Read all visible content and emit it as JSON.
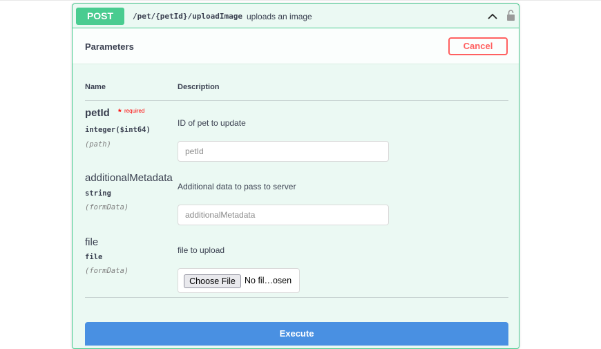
{
  "operation": {
    "method": "POST",
    "path": "/pet/{petId}/uploadImage",
    "summary": "uploads an image",
    "icons": [
      "chevron-up-icon",
      "lock-icon"
    ],
    "colors": {
      "method": "#49cc90",
      "background": "#ebf9f3",
      "cancel": "#ff6060",
      "execute": "#4990e2"
    }
  },
  "parameters_section": {
    "title": "Parameters",
    "cancel_label": "Cancel",
    "columns": {
      "name": "Name",
      "description": "Description"
    },
    "params": [
      {
        "name": "petId",
        "required_star": "*",
        "required_label": "required",
        "type": "integer($int64)",
        "in": "(path)",
        "description": "ID of pet to update",
        "placeholder": "petId"
      },
      {
        "name": "additionalMetadata",
        "type": "string",
        "in": "(formData)",
        "description": "Additional data to pass to server",
        "placeholder": "additionalMetadata"
      },
      {
        "name": "file",
        "type": "file",
        "in": "(formData)",
        "description": "file to upload",
        "choose_label": "Choose File",
        "file_status": "No fil…osen"
      }
    ]
  },
  "execute_label": "Execute"
}
